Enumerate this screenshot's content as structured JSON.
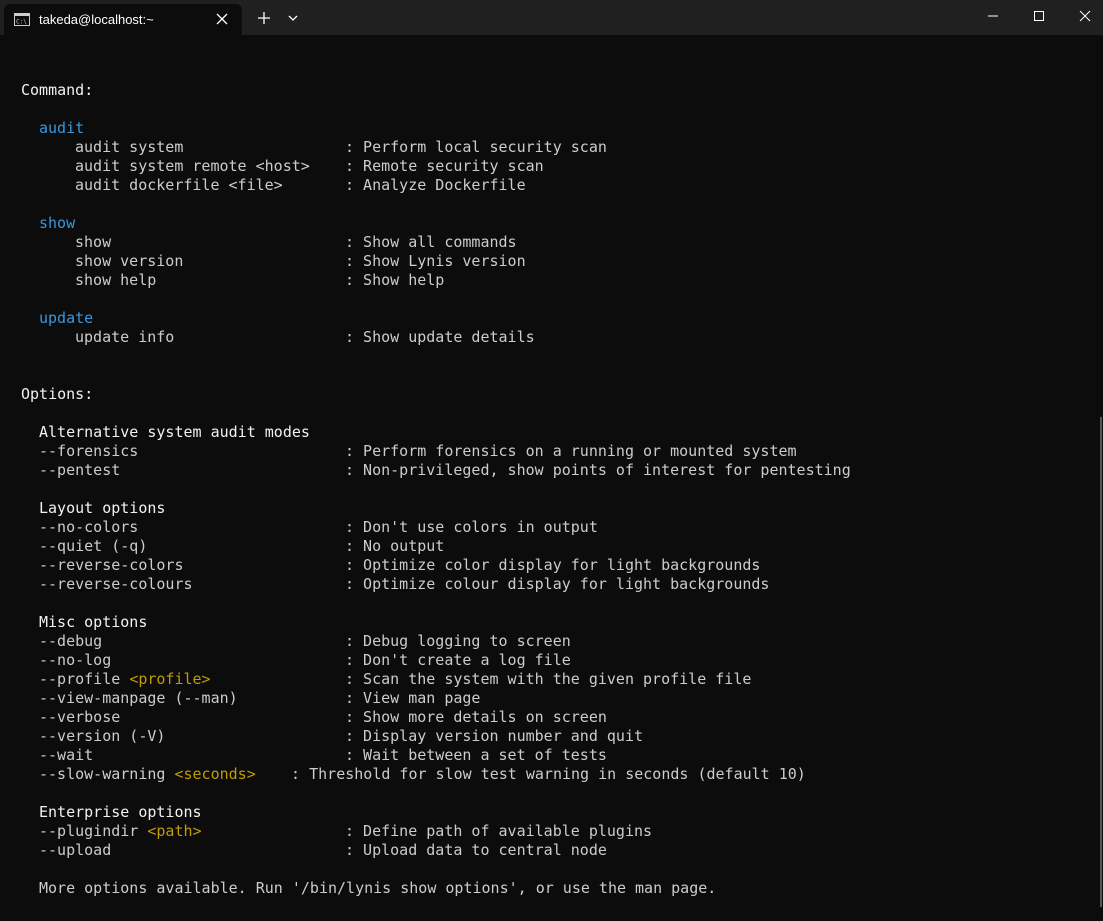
{
  "window": {
    "tab_title": "takeda@localhost:~",
    "new_tab": "+"
  },
  "terminal": {
    "command_header": "Command:",
    "groups": [
      {
        "name": "audit",
        "items": [
          {
            "cmd": "audit system",
            "desc": ": Perform local security scan"
          },
          {
            "cmd": "audit system remote <host>",
            "desc": ": Remote security scan"
          },
          {
            "cmd": "audit dockerfile <file>",
            "desc": ": Analyze Dockerfile"
          }
        ]
      },
      {
        "name": "show",
        "items": [
          {
            "cmd": "show",
            "desc": ": Show all commands"
          },
          {
            "cmd": "show version",
            "desc": ": Show Lynis version"
          },
          {
            "cmd": "show help",
            "desc": ": Show help"
          }
        ]
      },
      {
        "name": "update",
        "items": [
          {
            "cmd": "update info",
            "desc": ": Show update details"
          }
        ]
      }
    ],
    "options_header": "Options:",
    "option_groups": [
      {
        "name": "Alternative system audit modes",
        "items": [
          {
            "opt": "--forensics",
            "arg": "",
            "desc": ": Perform forensics on a running or mounted system"
          },
          {
            "opt": "--pentest",
            "arg": "",
            "desc": ": Non-privileged, show points of interest for pentesting"
          }
        ]
      },
      {
        "name": "Layout options",
        "items": [
          {
            "opt": "--no-colors",
            "arg": "",
            "desc": ": Don't use colors in output"
          },
          {
            "opt": "--quiet (-q)",
            "arg": "",
            "desc": ": No output"
          },
          {
            "opt": "--reverse-colors",
            "arg": "",
            "desc": ": Optimize color display for light backgrounds"
          },
          {
            "opt": "--reverse-colours",
            "arg": "",
            "desc": ": Optimize colour display for light backgrounds"
          }
        ]
      },
      {
        "name": "Misc options",
        "items": [
          {
            "opt": "--debug",
            "arg": "",
            "desc": ": Debug logging to screen"
          },
          {
            "opt": "--no-log",
            "arg": "",
            "desc": ": Don't create a log file"
          },
          {
            "opt": "--profile ",
            "arg": "<profile>",
            "desc": ": Scan the system with the given profile file"
          },
          {
            "opt": "--view-manpage (--man)",
            "arg": "",
            "desc": ": View man page"
          },
          {
            "opt": "--verbose",
            "arg": "",
            "desc": ": Show more details on screen"
          },
          {
            "opt": "--version (-V)",
            "arg": "",
            "desc": ": Display version number and quit"
          },
          {
            "opt": "--wait",
            "arg": "",
            "desc": ": Wait between a set of tests"
          },
          {
            "opt": "--slow-warning ",
            "arg": "<seconds>",
            "desc": "  : Threshold for slow test warning in seconds (default 10)"
          }
        ]
      },
      {
        "name": "Enterprise options",
        "items": [
          {
            "opt": "--plugindir ",
            "arg": "<path>",
            "desc": ": Define path of available plugins"
          },
          {
            "opt": "--upload",
            "arg": "",
            "desc": ": Upload data to central node"
          }
        ]
      }
    ],
    "footer": "More options available. Run '/bin/lynis show options', or use the man page."
  },
  "colors": {
    "background": "#0c0c0c",
    "titlebar": "#202020",
    "text": "#cccccc",
    "heading": "#f2f2f2",
    "group": "#3a96dd",
    "argument": "#c19c00"
  }
}
